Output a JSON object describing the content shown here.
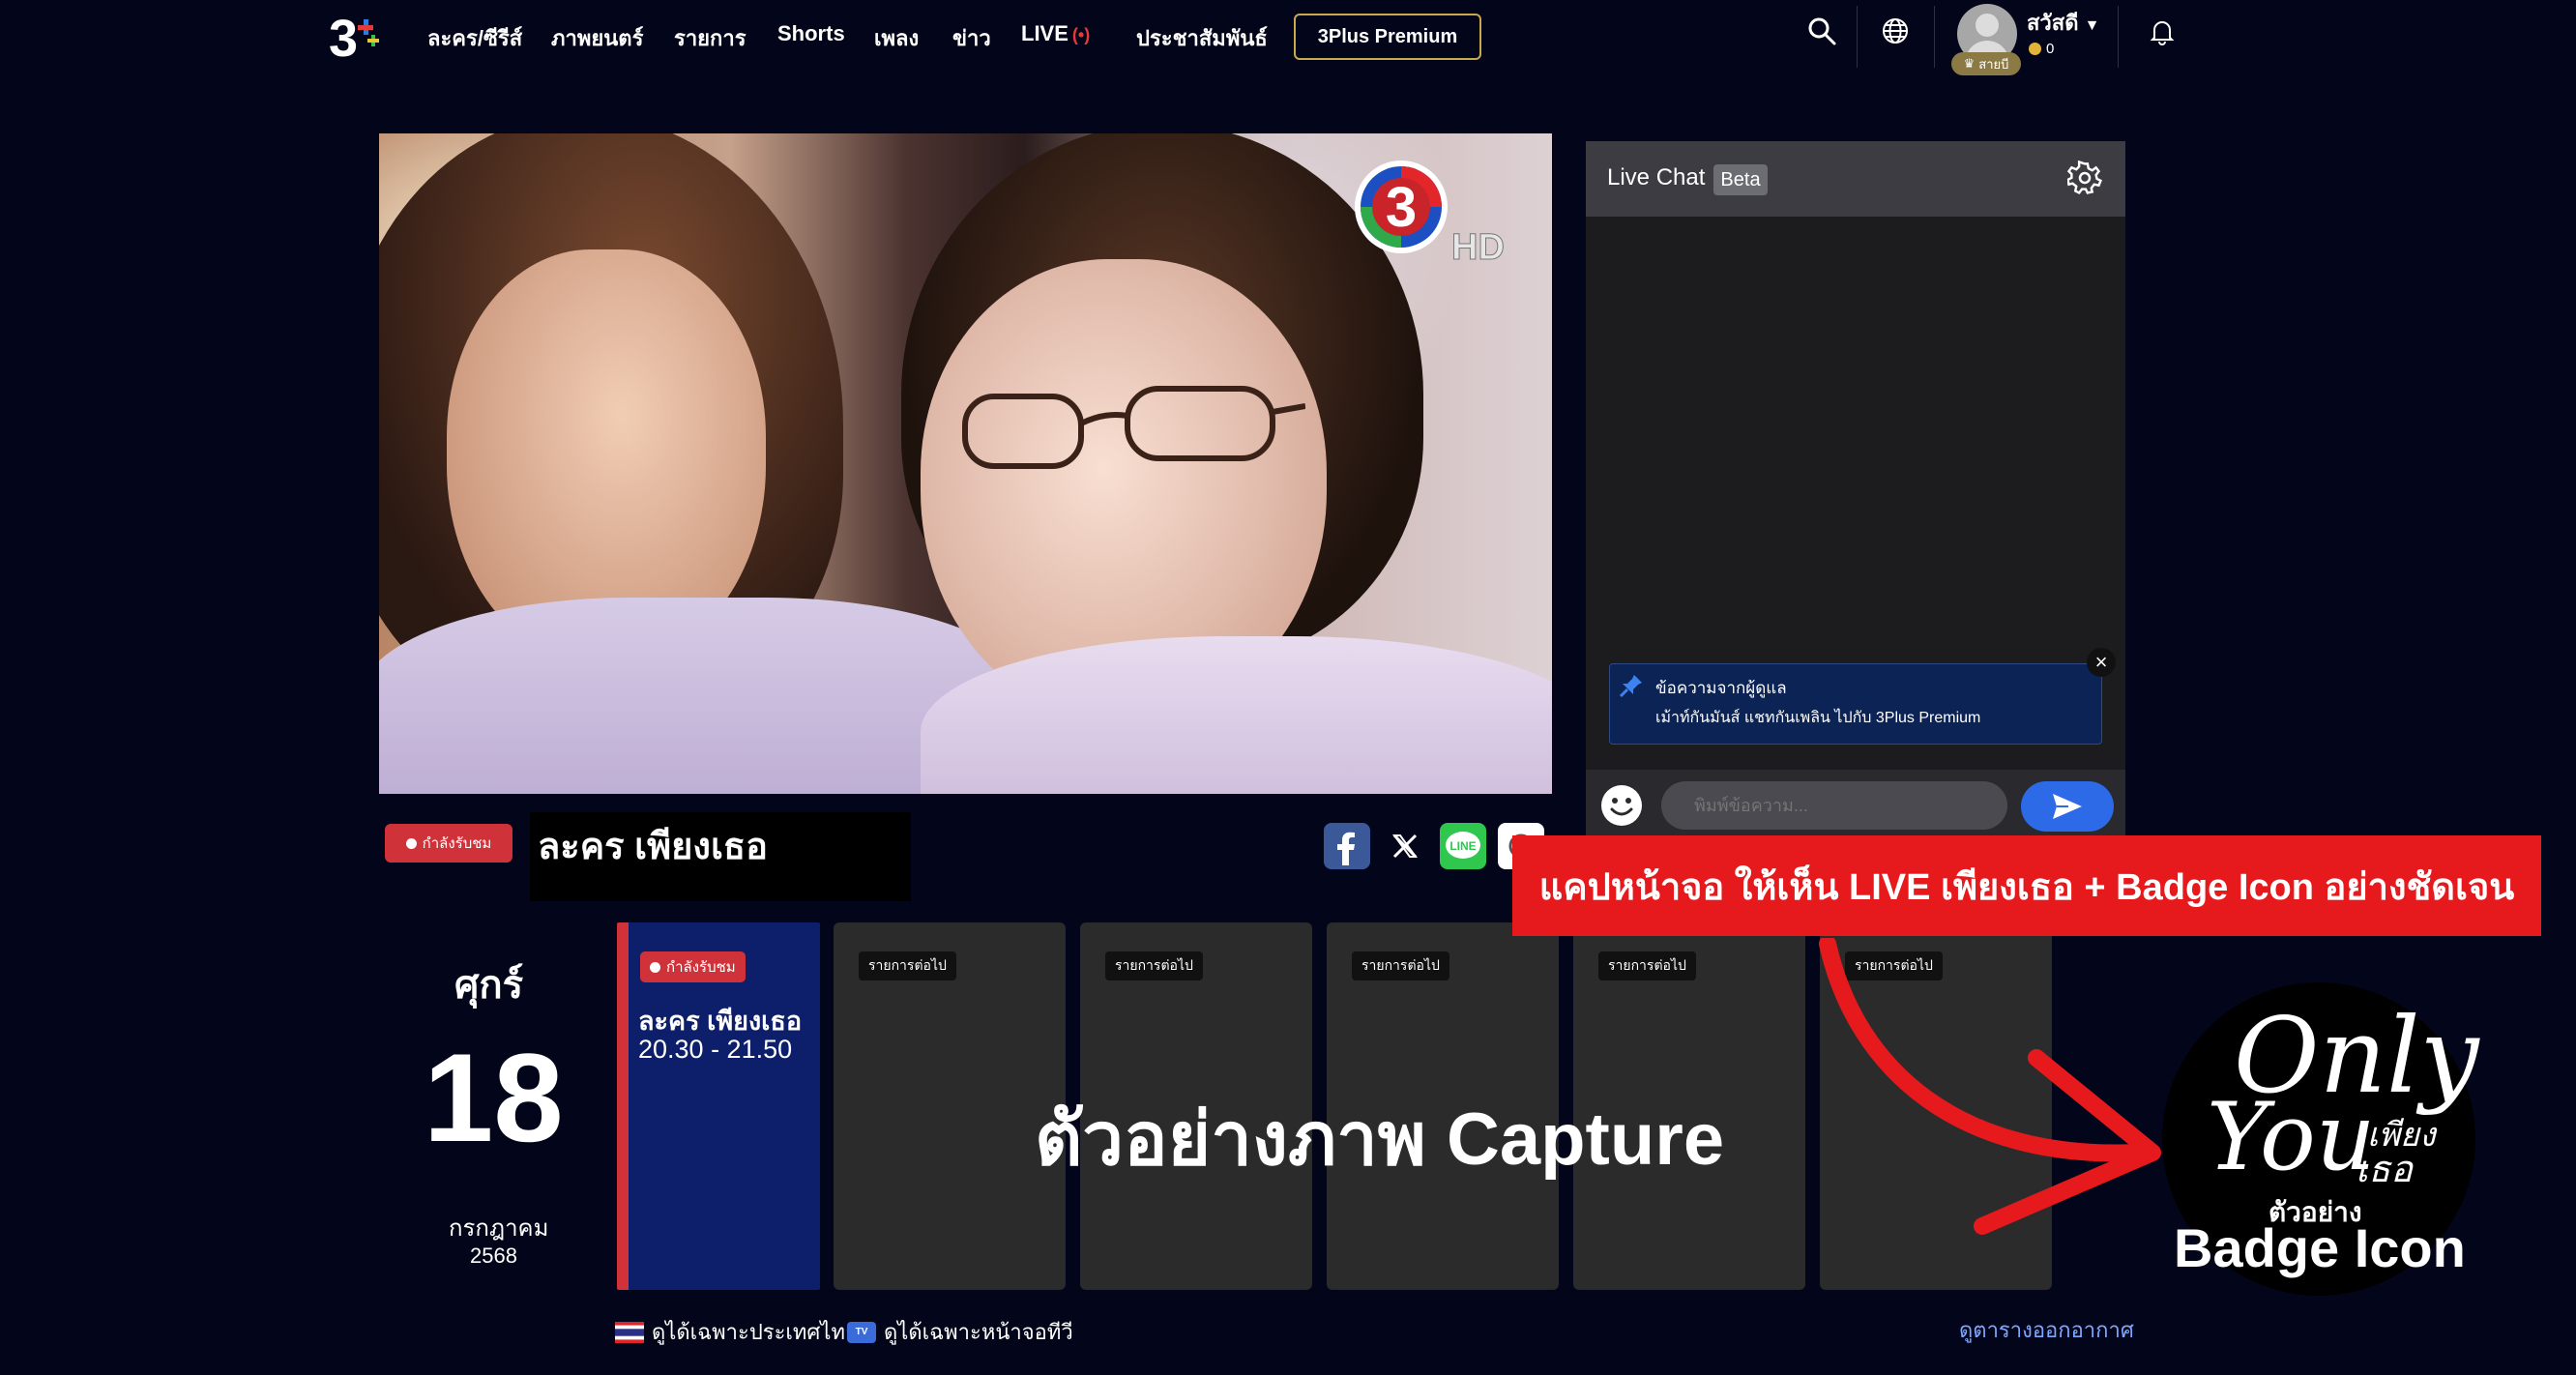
{
  "header": {
    "logo_text": "3+",
    "nav": [
      {
        "label": "ละคร/ซีรีส์"
      },
      {
        "label": "ภาพยนตร์"
      },
      {
        "label": "รายการ"
      },
      {
        "label": "Shorts"
      },
      {
        "label": "เพลง"
      },
      {
        "label": "ข่าว"
      },
      {
        "label": "LIVE",
        "live_indicator": "(•)"
      },
      {
        "label": "ประชาสัมพันธ์"
      }
    ],
    "premium_button": "3Plus Premium",
    "icons": [
      "search-icon",
      "globe-icon",
      "bell-icon"
    ],
    "user": {
      "greeting": "สวัสดี",
      "rank": "สายบี",
      "coins": "0"
    }
  },
  "player": {
    "channel_logo": "3",
    "channel_logo_suffix": "HD"
  },
  "now_watching": {
    "badge": "กำลังรับชม",
    "title": "ละคร เพียงเธอ",
    "share_icons": [
      "facebook-icon",
      "x-icon",
      "line-icon",
      "copy-link-icon"
    ]
  },
  "chat": {
    "title": "Live Chat",
    "beta": "Beta",
    "pinned_title": "ข้อความจากผู้ดูแล",
    "pinned_message": "เม้าท์กันมันส์ แชทกันเพลิน ไปกับ 3Plus Premium",
    "input_placeholder": "พิมพ์ข้อความ...",
    "close": "×"
  },
  "schedule": {
    "day_name": "ศุกร์",
    "day_number": "18",
    "month": "กรกฎาคม",
    "year": "2568",
    "current": {
      "badge": "กำลังรับชม",
      "title": "ละคร เพียงเธอ",
      "time": "20.30 - 21.50"
    },
    "next_label": "รายการต่อไป",
    "next_count": 5,
    "region_th": "ดูได้เฉพาะประเทศไทย",
    "region_tv": "ดูได้เฉพาะหน้าจอทีวี",
    "tv_badge": "TV",
    "schedule_link": "ดูตารางออกอากาศ"
  },
  "annotation": {
    "banner": "แคปหน้าจอ ให้เห็น LIVE เพียงเธอ + Badge Icon อย่างชัดเจน",
    "capture_text": "ตัวอย่างภาพ Capture",
    "badge_only": "Only",
    "badge_you": "You",
    "badge_th_1": "เพียง",
    "badge_th_2": "เธอ",
    "badge_sub": "ตัวอย่าง",
    "badge_main": "Badge Icon"
  },
  "colors": {
    "background": "#03061a",
    "live_red": "#d0323a",
    "current_card": "#0d1f6b",
    "send_blue": "#2c6ae8",
    "premium_border": "#c9a94e",
    "banner_red": "#e6191d"
  }
}
